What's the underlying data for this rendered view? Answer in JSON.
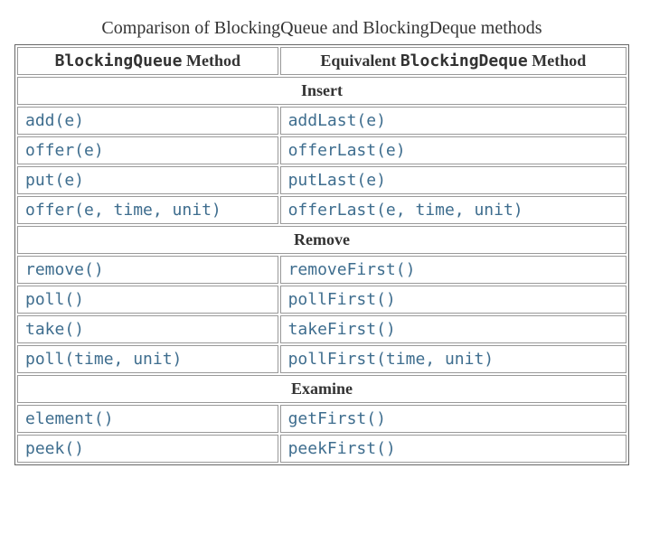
{
  "table": {
    "caption": "Comparison of BlockingQueue and BlockingDeque methods",
    "header": {
      "col1_code": "BlockingQueue",
      "col1_suffix": " Method",
      "col2_prefix": "Equivalent ",
      "col2_code": "BlockingDeque",
      "col2_suffix": " Method"
    },
    "sections": {
      "insert": {
        "title": "Insert",
        "rows": [
          {
            "left": "add(e)",
            "right": "addLast(e)"
          },
          {
            "left": "offer(e)",
            "right": "offerLast(e)"
          },
          {
            "left": "put(e)",
            "right": "putLast(e)"
          },
          {
            "left": "offer(e, time, unit)",
            "right": "offerLast(e, time, unit)"
          }
        ]
      },
      "remove": {
        "title": "Remove",
        "rows": [
          {
            "left": "remove()",
            "right": "removeFirst()"
          },
          {
            "left": "poll()",
            "right": "pollFirst()"
          },
          {
            "left": "take()",
            "right": "takeFirst()"
          },
          {
            "left": "poll(time, unit)",
            "right": "pollFirst(time, unit)"
          }
        ]
      },
      "examine": {
        "title": "Examine",
        "rows": [
          {
            "left": "element()",
            "right": "getFirst()"
          },
          {
            "left": "peek()",
            "right": "peekFirst()"
          }
        ]
      }
    }
  }
}
